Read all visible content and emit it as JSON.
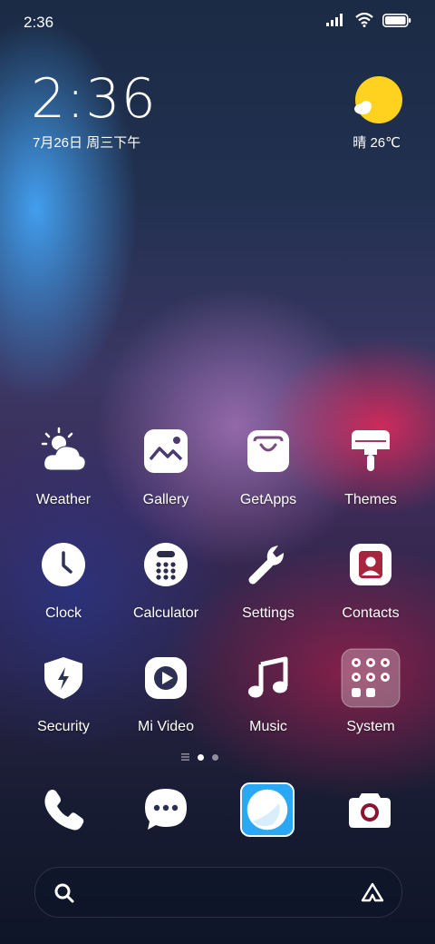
{
  "status_bar": {
    "time": "2:36"
  },
  "clock_widget": {
    "time": "2:36",
    "date": "7月26日 周三下午"
  },
  "weather_widget": {
    "text": "晴 26℃",
    "icon": "sun-cloud-icon",
    "sun_color": "#FFD21F"
  },
  "apps": [
    {
      "label": "Weather",
      "icon": "weather-icon"
    },
    {
      "label": "Gallery",
      "icon": "gallery-icon"
    },
    {
      "label": "GetApps",
      "icon": "getapps-icon"
    },
    {
      "label": "Themes",
      "icon": "themes-icon"
    },
    {
      "label": "Clock",
      "icon": "clock-icon"
    },
    {
      "label": "Calculator",
      "icon": "calculator-icon"
    },
    {
      "label": "Settings",
      "icon": "settings-icon"
    },
    {
      "label": "Contacts",
      "icon": "contacts-icon"
    },
    {
      "label": "Security",
      "icon": "security-icon"
    },
    {
      "label": "Mi Video",
      "icon": "mi-video-icon"
    },
    {
      "label": "Music",
      "icon": "music-icon"
    },
    {
      "label": "System",
      "icon": "system-folder-icon"
    }
  ],
  "page_indicator": {
    "pages": 2,
    "current": 1
  },
  "dock": [
    {
      "icon": "phone-icon"
    },
    {
      "icon": "messages-icon"
    },
    {
      "icon": "browser-icon"
    },
    {
      "icon": "camera-icon"
    }
  ],
  "search_bar": {
    "icon_left": "search-icon",
    "icon_right": "assistant-icon"
  },
  "colors": {
    "camera_accent": "#8B1430",
    "browser_accent": "#2AA7F5"
  }
}
